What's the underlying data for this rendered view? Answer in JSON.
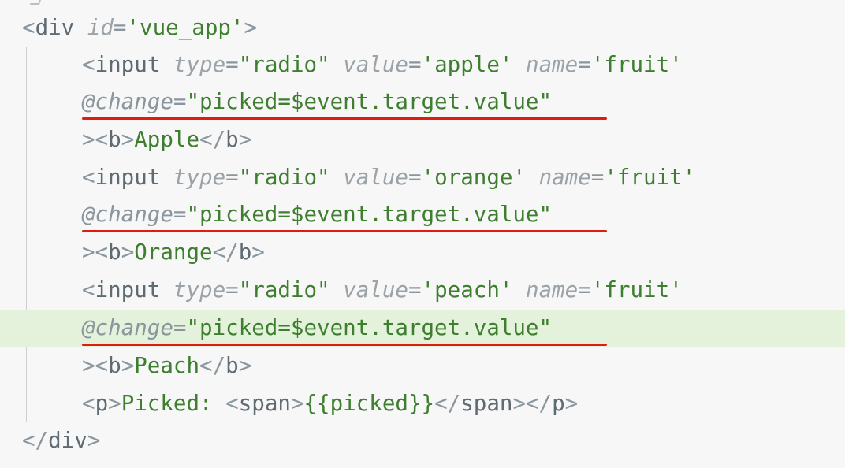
{
  "editor": {
    "lines": [
      {
        "tokens": [
          {
            "t": "<",
            "c": "punct"
          },
          {
            "t": "div",
            "c": "tag"
          },
          {
            "t": " ",
            "c": "punct"
          },
          {
            "t": "id",
            "c": "attr"
          },
          {
            "t": "=",
            "c": "punct"
          },
          {
            "t": "'vue_app'",
            "c": "str"
          },
          {
            "t": ">",
            "c": "punct"
          }
        ]
      },
      {
        "tokens": [
          {
            "t": "<",
            "c": "punct"
          },
          {
            "t": "input",
            "c": "tag"
          },
          {
            "t": " ",
            "c": "punct"
          },
          {
            "t": "type",
            "c": "attr"
          },
          {
            "t": "=",
            "c": "punct"
          },
          {
            "t": "\"radio\"",
            "c": "str"
          },
          {
            "t": " ",
            "c": "punct"
          },
          {
            "t": "value",
            "c": "attr"
          },
          {
            "t": "=",
            "c": "punct"
          },
          {
            "t": "'apple'",
            "c": "str"
          },
          {
            "t": " ",
            "c": "punct"
          },
          {
            "t": "name",
            "c": "attr"
          },
          {
            "t": "=",
            "c": "punct"
          },
          {
            "t": "'fruit'",
            "c": "str"
          }
        ]
      },
      {
        "tokens": [
          {
            "t": "@change",
            "c": "directive"
          },
          {
            "t": "=",
            "c": "punct"
          },
          {
            "t": "\"picked=$event.target.value\"",
            "c": "str"
          }
        ],
        "underlined": true
      },
      {
        "tokens": [
          {
            "t": "><",
            "c": "punct"
          },
          {
            "t": "b",
            "c": "tag"
          },
          {
            "t": ">",
            "c": "punct"
          },
          {
            "t": "Apple",
            "c": "text"
          },
          {
            "t": "</",
            "c": "punct"
          },
          {
            "t": "b",
            "c": "tag"
          },
          {
            "t": ">",
            "c": "punct"
          }
        ]
      },
      {
        "tokens": [
          {
            "t": "<",
            "c": "punct"
          },
          {
            "t": "input",
            "c": "tag"
          },
          {
            "t": " ",
            "c": "punct"
          },
          {
            "t": "type",
            "c": "attr"
          },
          {
            "t": "=",
            "c": "punct"
          },
          {
            "t": "\"radio\"",
            "c": "str"
          },
          {
            "t": " ",
            "c": "punct"
          },
          {
            "t": "value",
            "c": "attr"
          },
          {
            "t": "=",
            "c": "punct"
          },
          {
            "t": "'orange'",
            "c": "str"
          },
          {
            "t": " ",
            "c": "punct"
          },
          {
            "t": "name",
            "c": "attr"
          },
          {
            "t": "=",
            "c": "punct"
          },
          {
            "t": "'fruit'",
            "c": "str"
          }
        ]
      },
      {
        "tokens": [
          {
            "t": "@change",
            "c": "directive"
          },
          {
            "t": "=",
            "c": "punct"
          },
          {
            "t": "\"picked=$event.target.value\"",
            "c": "str"
          }
        ],
        "underlined": true
      },
      {
        "tokens": [
          {
            "t": "><",
            "c": "punct"
          },
          {
            "t": "b",
            "c": "tag"
          },
          {
            "t": ">",
            "c": "punct"
          },
          {
            "t": "Orange",
            "c": "text"
          },
          {
            "t": "</",
            "c": "punct"
          },
          {
            "t": "b",
            "c": "tag"
          },
          {
            "t": ">",
            "c": "punct"
          }
        ]
      },
      {
        "tokens": [
          {
            "t": "<",
            "c": "punct"
          },
          {
            "t": "input",
            "c": "tag"
          },
          {
            "t": " ",
            "c": "punct"
          },
          {
            "t": "type",
            "c": "attr"
          },
          {
            "t": "=",
            "c": "punct"
          },
          {
            "t": "\"radio\"",
            "c": "str"
          },
          {
            "t": " ",
            "c": "punct"
          },
          {
            "t": "value",
            "c": "attr"
          },
          {
            "t": "=",
            "c": "punct"
          },
          {
            "t": "'peach'",
            "c": "str"
          },
          {
            "t": " ",
            "c": "punct"
          },
          {
            "t": "name",
            "c": "attr"
          },
          {
            "t": "=",
            "c": "punct"
          },
          {
            "t": "'fruit'",
            "c": "str"
          }
        ]
      },
      {
        "tokens": [
          {
            "t": "@change",
            "c": "directive"
          },
          {
            "t": "=",
            "c": "punct"
          },
          {
            "t": "\"picked=$event.target.value\"",
            "c": "str"
          }
        ],
        "underlined": true,
        "highlighted": true
      },
      {
        "tokens": [
          {
            "t": "><",
            "c": "punct"
          },
          {
            "t": "b",
            "c": "tag"
          },
          {
            "t": ">",
            "c": "punct"
          },
          {
            "t": "Peach",
            "c": "text"
          },
          {
            "t": "</",
            "c": "punct"
          },
          {
            "t": "b",
            "c": "tag"
          },
          {
            "t": ">",
            "c": "punct"
          }
        ]
      },
      {
        "tokens": [
          {
            "t": "<",
            "c": "punct"
          },
          {
            "t": "p",
            "c": "tag"
          },
          {
            "t": ">",
            "c": "punct"
          },
          {
            "t": "Picked: ",
            "c": "text"
          },
          {
            "t": "<",
            "c": "punct"
          },
          {
            "t": "span",
            "c": "tag"
          },
          {
            "t": ">",
            "c": "punct"
          },
          {
            "t": "{{picked}}",
            "c": "text"
          },
          {
            "t": "</",
            "c": "punct"
          },
          {
            "t": "span",
            "c": "tag"
          },
          {
            "t": "></",
            "c": "punct"
          },
          {
            "t": "p",
            "c": "tag"
          },
          {
            "t": ">",
            "c": "punct"
          }
        ]
      },
      {
        "tokens": [
          {
            "t": "</",
            "c": "punct"
          },
          {
            "t": "div",
            "c": "tag"
          },
          {
            "t": ">",
            "c": "punct"
          }
        ]
      }
    ]
  },
  "colors": {
    "background": "#f7f7f7",
    "line_highlight": "#e4f2db",
    "underline": "#e01b10",
    "string": "#3d7f2f"
  }
}
